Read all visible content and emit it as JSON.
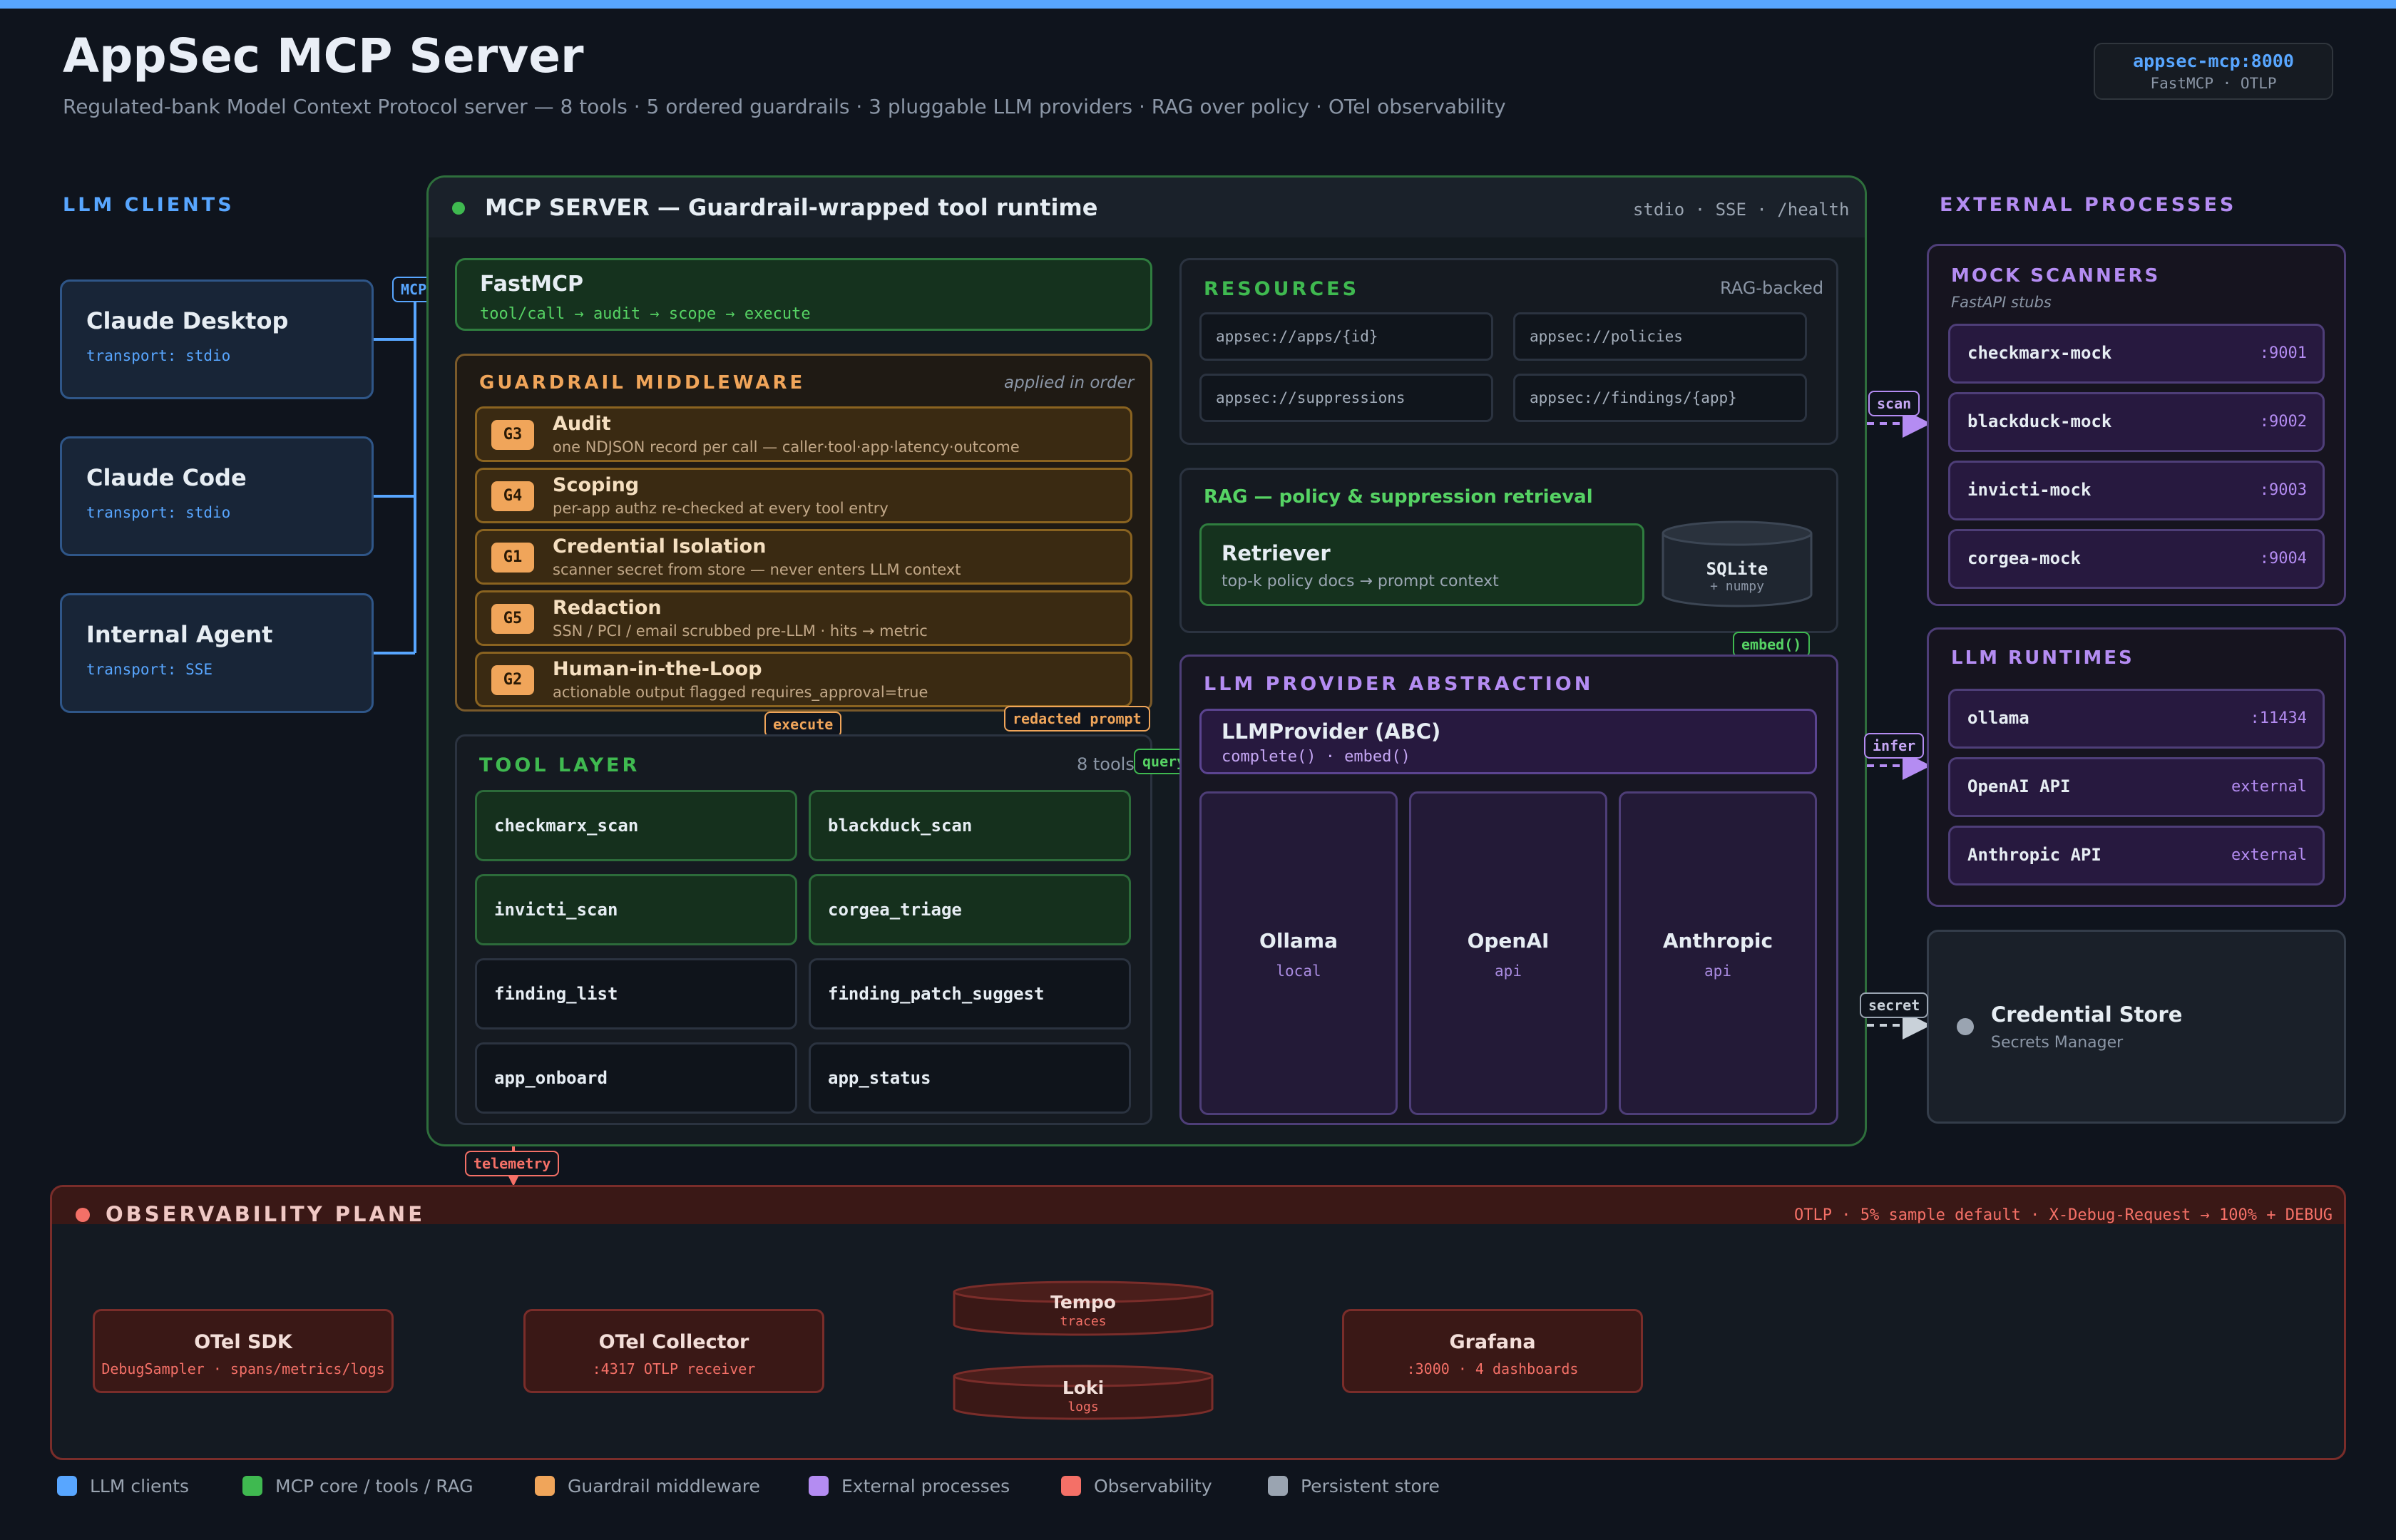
{
  "header": {
    "title": "AppSec MCP Server",
    "subtitle": "Regulated-bank Model Context Protocol server — 8 tools · 5 ordered guardrails · 3 pluggable LLM providers · RAG over policy · OTel observability",
    "endpoint": "appsec-mcp:8000",
    "endpoint_sub": "FastMCP · OTLP"
  },
  "clients": {
    "heading": "LLM CLIENTS",
    "items": [
      {
        "name": "Claude Desktop",
        "transport": "transport: stdio"
      },
      {
        "name": "Claude Code",
        "transport": "transport: stdio"
      },
      {
        "name": "Internal Agent",
        "transport": "transport: SSE"
      }
    ]
  },
  "server": {
    "title": "MCP SERVER — Guardrail-wrapped tool runtime",
    "transports": "stdio · SSE · /health",
    "fastmcp": {
      "name": "FastMCP",
      "flow": "tool/call → audit → scope → execute"
    },
    "guardrails": {
      "heading": "GUARDRAIL MIDDLEWARE",
      "note": "applied in order",
      "items": [
        {
          "id": "G3",
          "name": "Audit",
          "desc": "one NDJSON record per call — caller·tool·app·latency·outcome"
        },
        {
          "id": "G4",
          "name": "Scoping",
          "desc": "per-app authz re-checked at every tool entry"
        },
        {
          "id": "G1",
          "name": "Credential Isolation",
          "desc": "scanner secret from store — never enters LLM context"
        },
        {
          "id": "G5",
          "name": "Redaction",
          "desc": "SSN / PCI / email scrubbed pre-LLM · hits → metric"
        },
        {
          "id": "G2",
          "name": "Human-in-the-Loop",
          "desc": "actionable output flagged requires_approval=true"
        }
      ]
    },
    "tools": {
      "heading": "TOOL LAYER",
      "count": "8 tools",
      "items": [
        "checkmarx_scan",
        "blackduck_scan",
        "invicti_scan",
        "corgea_triage",
        "finding_list",
        "finding_patch_suggest",
        "app_onboard",
        "app_status"
      ]
    },
    "resources": {
      "heading": "RESOURCES",
      "note": "RAG-backed",
      "uris": [
        "appsec://apps/{id}",
        "appsec://policies",
        "appsec://suppressions",
        "appsec://findings/{app}"
      ]
    },
    "rag": {
      "heading": "RAG — policy & suppression retrieval",
      "retriever": "Retriever",
      "retriever_desc": "top-k policy docs → prompt context",
      "store": "SQLite",
      "store_sub": "+ numpy"
    },
    "llm": {
      "heading": "LLM PROVIDER ABSTRACTION",
      "abc": "LLMProvider (ABC)",
      "abc_methods": "complete() · embed()",
      "providers": [
        {
          "name": "Ollama",
          "kind": "local"
        },
        {
          "name": "OpenAI",
          "kind": "api"
        },
        {
          "name": "Anthropic",
          "kind": "api"
        }
      ]
    }
  },
  "edges": {
    "mcp": "MCP",
    "execute": "execute",
    "redacted": "redacted prompt",
    "query": "query",
    "embed": "embed()",
    "scan": "scan",
    "infer": "infer",
    "secret": "secret",
    "telemetry": "telemetry"
  },
  "external": {
    "heading": "EXTERNAL PROCESSES",
    "scanners": {
      "heading": "MOCK SCANNERS",
      "sub": "FastAPI stubs",
      "items": [
        {
          "name": "checkmarx-mock",
          "port": ":9001"
        },
        {
          "name": "blackduck-mock",
          "port": ":9002"
        },
        {
          "name": "invicti-mock",
          "port": ":9003"
        },
        {
          "name": "corgea-mock",
          "port": ":9004"
        }
      ]
    },
    "runtimes": {
      "heading": "LLM RUNTIMES",
      "items": [
        {
          "name": "ollama",
          "port": ":11434"
        },
        {
          "name": "OpenAI API",
          "port": "external"
        },
        {
          "name": "Anthropic API",
          "port": "external"
        }
      ]
    },
    "credential": {
      "name": "Credential Store",
      "sub": "Secrets Manager"
    }
  },
  "observability": {
    "heading": "OBSERVABILITY PLANE",
    "note": "OTLP · 5% sample default · X-Debug-Request → 100% + DEBUG",
    "sdk": {
      "name": "OTel SDK",
      "sub": "DebugSampler · spans/metrics/logs"
    },
    "collector": {
      "name": "OTel Collector",
      "sub": ":4317 OTLP receiver"
    },
    "tempo": {
      "name": "Tempo",
      "sub": "traces"
    },
    "loki": {
      "name": "Loki",
      "sub": "logs"
    },
    "grafana": {
      "name": "Grafana",
      "sub": ":3000 · 4 dashboards"
    }
  },
  "legend": [
    {
      "label": "LLM clients",
      "color": "#58a6ff"
    },
    {
      "label": "MCP core / tools / RAG",
      "color": "#3fb950"
    },
    {
      "label": "Guardrail middleware",
      "color": "#f0a55a"
    },
    {
      "label": "External processes",
      "color": "#b48cf2"
    },
    {
      "label": "Observability",
      "color": "#f47067"
    },
    {
      "label": "Persistent store",
      "color": "#9aa4b1"
    }
  ]
}
